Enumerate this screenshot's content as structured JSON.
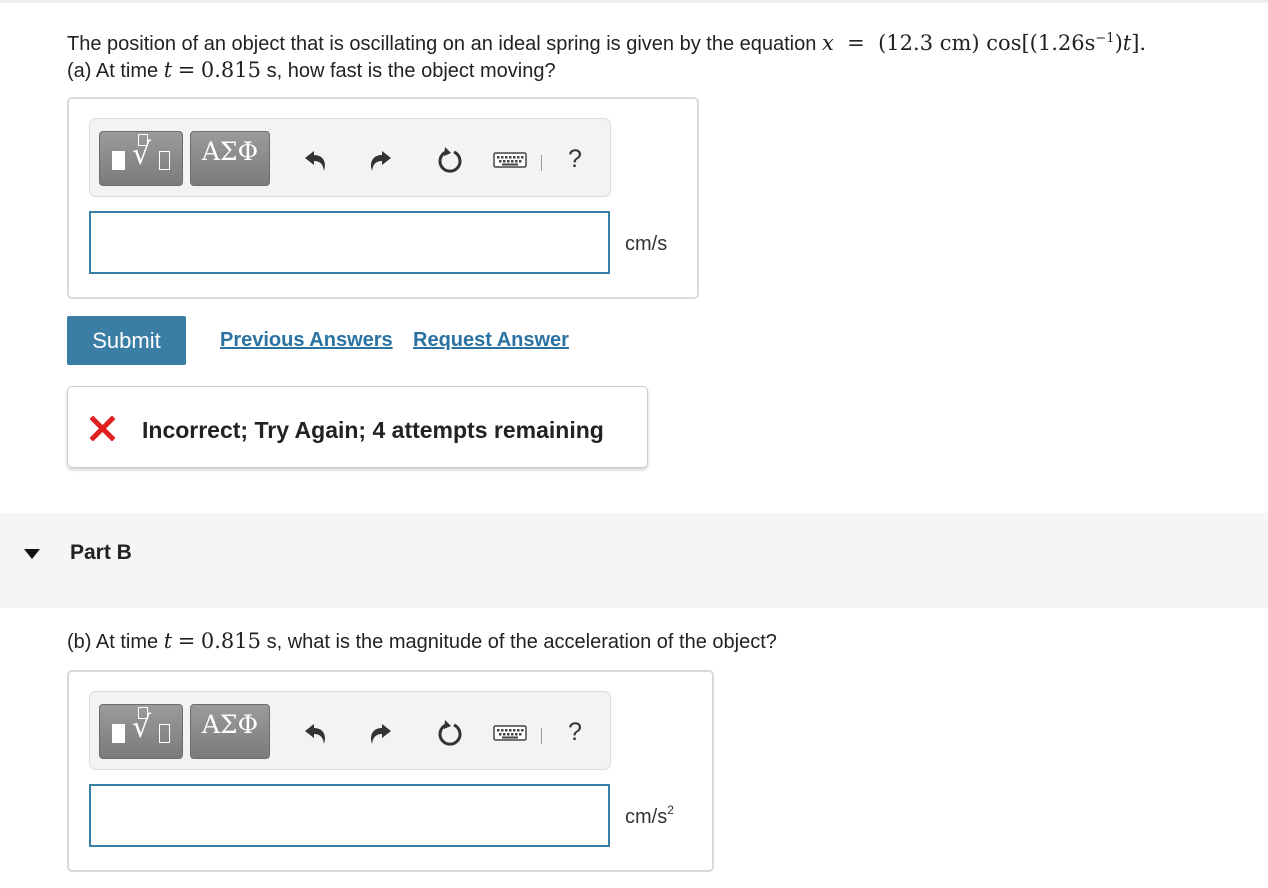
{
  "partA": {
    "intro": "The position of an object that is oscillating on an ideal spring is given by the equation",
    "equation": {
      "lhs": "x",
      "eq": "=",
      "amp": "(12.3 cm)",
      "cos_open": "cos[(1.26s",
      "exp": "−1",
      "arg_close": ")",
      "t": "t",
      "end": "]."
    },
    "question_prefix": "(a) At time",
    "t_var": "t",
    "eq": "=",
    "t_value": "0.815",
    "question_suffix": "s, how fast is the object moving?",
    "toolbar": {
      "templates_icon": "templates-icon",
      "greek_label": "ΑΣΦ",
      "help_label": "?"
    },
    "answer_value": "",
    "unit": "cm/s"
  },
  "actions": {
    "submit": "Submit",
    "previous_answers": "Previous Answers",
    "request_answer": "Request Answer"
  },
  "feedback": {
    "icon": "x-icon",
    "color": "#e02020",
    "text": "Incorrect; Try Again; 4 attempts remaining"
  },
  "partB": {
    "header": "Part B",
    "question_prefix": "(b) At time",
    "t_var": "t",
    "eq": "=",
    "t_value": "0.815",
    "question_suffix": "s, what is the magnitude of the acceleration of the object?",
    "toolbar": {
      "templates_icon": "templates-icon",
      "greek_label": "ΑΣΦ",
      "help_label": "?"
    },
    "answer_value": "",
    "unit": "cm/s",
    "unit_exp": "2"
  },
  "colors": {
    "submit_bg": "#3a7ea6",
    "link": "#2a72a2",
    "input_border": "#3a7fa8",
    "section_bg": "#f5f5f5"
  }
}
